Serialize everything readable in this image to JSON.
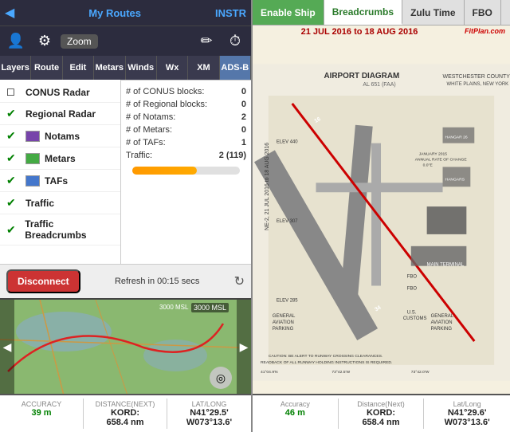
{
  "left": {
    "topBar": {
      "backLabel": "◀",
      "myRoutesLabel": "My Routes",
      "instrLabel": "INSTR"
    },
    "iconRow": {
      "personIcon": "👤",
      "gearIcon": "⚙",
      "zoomLabel": "Zoom",
      "pencilIcon": "✏",
      "timerIcon": "⏱"
    },
    "navTabs": [
      {
        "id": "layers",
        "label": "Layers",
        "active": false
      },
      {
        "id": "route",
        "label": "Route",
        "active": false
      },
      {
        "id": "edit",
        "label": "Edit",
        "active": false
      },
      {
        "id": "metars",
        "label": "Metars",
        "active": false
      },
      {
        "id": "winds",
        "label": "Winds",
        "active": false
      },
      {
        "id": "wx",
        "label": "Wx",
        "active": false
      },
      {
        "id": "xm",
        "label": "XM",
        "active": false
      },
      {
        "id": "ads-b",
        "label": "ADS-B",
        "active": true
      }
    ],
    "layers": [
      {
        "id": "conus-radar",
        "name": "CONUS Radar",
        "checked": false,
        "colorBox": null
      },
      {
        "id": "regional-radar",
        "name": "Regional Radar",
        "checked": true,
        "colorBox": null
      },
      {
        "id": "notams",
        "name": "Notams",
        "checked": true,
        "colorBox": "#7744aa"
      },
      {
        "id": "metars",
        "name": "Metars",
        "checked": true,
        "colorBox": "#44aa44"
      },
      {
        "id": "tafs",
        "name": "TAFs",
        "checked": true,
        "colorBox": "#4477cc"
      },
      {
        "id": "traffic",
        "name": "Traffic",
        "checked": true,
        "colorBox": null
      },
      {
        "id": "traffic-breadcrumbs",
        "name": "Traffic Breadcrumbs",
        "checked": true,
        "colorBox": null
      }
    ],
    "stats": [
      {
        "label": "# of CONUS blocks:",
        "value": "0"
      },
      {
        "label": "# of Regional blocks:",
        "value": "0"
      },
      {
        "label": "# of Notams:",
        "value": "2"
      },
      {
        "label": "# of Metars:",
        "value": "0"
      },
      {
        "label": "# of TAFs:",
        "value": "1"
      },
      {
        "label": "Traffic:",
        "value": "2 (119)"
      }
    ],
    "actionRow": {
      "disconnectLabel": "Disconnect",
      "refreshLabel": "Refresh in 00:15 secs",
      "refreshIcon": "↻"
    },
    "mapBottom": {
      "altitude": "3000 MSL",
      "arrowLeft": "◀",
      "arrowRight": "▶",
      "gpsIcon": "◎"
    },
    "bottomInfo": [
      {
        "label": "Accuracy",
        "value": "39 m",
        "green": true
      },
      {
        "label": "Distance(Next)\nKORD:",
        "value": "658.4 nm",
        "green": false
      },
      {
        "label": "Lat/Long",
        "value": "N41°29.5'",
        "value2": "W073°13.6'",
        "green": false
      }
    ]
  },
  "right": {
    "tabs": [
      {
        "id": "enable-ship",
        "label": "Enable Ship",
        "active": false,
        "green": true
      },
      {
        "id": "breadcrumbs",
        "label": "Breadcrumbs",
        "active": true,
        "green": false
      },
      {
        "id": "zulu-time",
        "label": "Zulu Time",
        "active": false,
        "green": false
      },
      {
        "id": "fbo",
        "label": "FBO",
        "active": false,
        "green": false
      }
    ],
    "airportHeader": {
      "date": "21 JUL 2016 to 18 AUG 2016",
      "title": "AIRPORT DIAGRAM",
      "subtitle": "AL 651 (FAA)",
      "county": "WESTCHESTER COUNTY (HPN)",
      "location": "WHITE PLAINS, NEW YORK",
      "fitplanLabel": "FitPlan.com"
    },
    "bottomInfo": [
      {
        "label": "Accuracy",
        "value": "46 m",
        "green": true
      },
      {
        "label": "Distance(Next)\nKORD:",
        "value": "658.4 nm",
        "green": false
      },
      {
        "label": "Lat/Long",
        "value": "N41°29.6'",
        "value2": "W073°13.6'",
        "green": false
      }
    ]
  }
}
